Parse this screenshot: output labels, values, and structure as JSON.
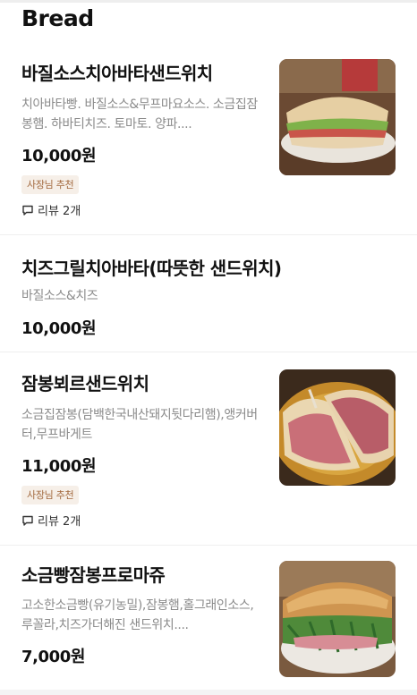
{
  "section": {
    "title": "Bread"
  },
  "items": [
    {
      "name": "바질소스치아바타샌드위치",
      "description": "치아바타빵. 바질소스&무프마요소스. 소금집잠봉햄. 하바티치즈. 토마토. 양파....",
      "price": "10,000원",
      "badge": "사장님 추천",
      "review": "리뷰 2개"
    },
    {
      "name": "치즈그릴치아바타(따뜻한 샌드위치)",
      "description": "바질소스&치즈",
      "price": "10,000원"
    },
    {
      "name": "잠봉뵈르샌드위치",
      "description": "소금집잠봉(담백한국내산돼지뒷다리햄),앵커버터,무프바게트",
      "price": "11,000원",
      "badge": "사장님 추천",
      "review": "리뷰 2개"
    },
    {
      "name": "소금빵잠봉프로마쥬",
      "description": "고소한소금빵(유기농밀),잠봉햄,홀그래인소스,루꼴라,치즈가더해진 샌드위치....",
      "price": "7,000원"
    }
  ],
  "icons": {
    "review": "speech-bubble-icon"
  },
  "colors": {
    "badge_text": "#a2683d",
    "badge_bg": "#f6efe8",
    "description": "#8b8b8b"
  }
}
